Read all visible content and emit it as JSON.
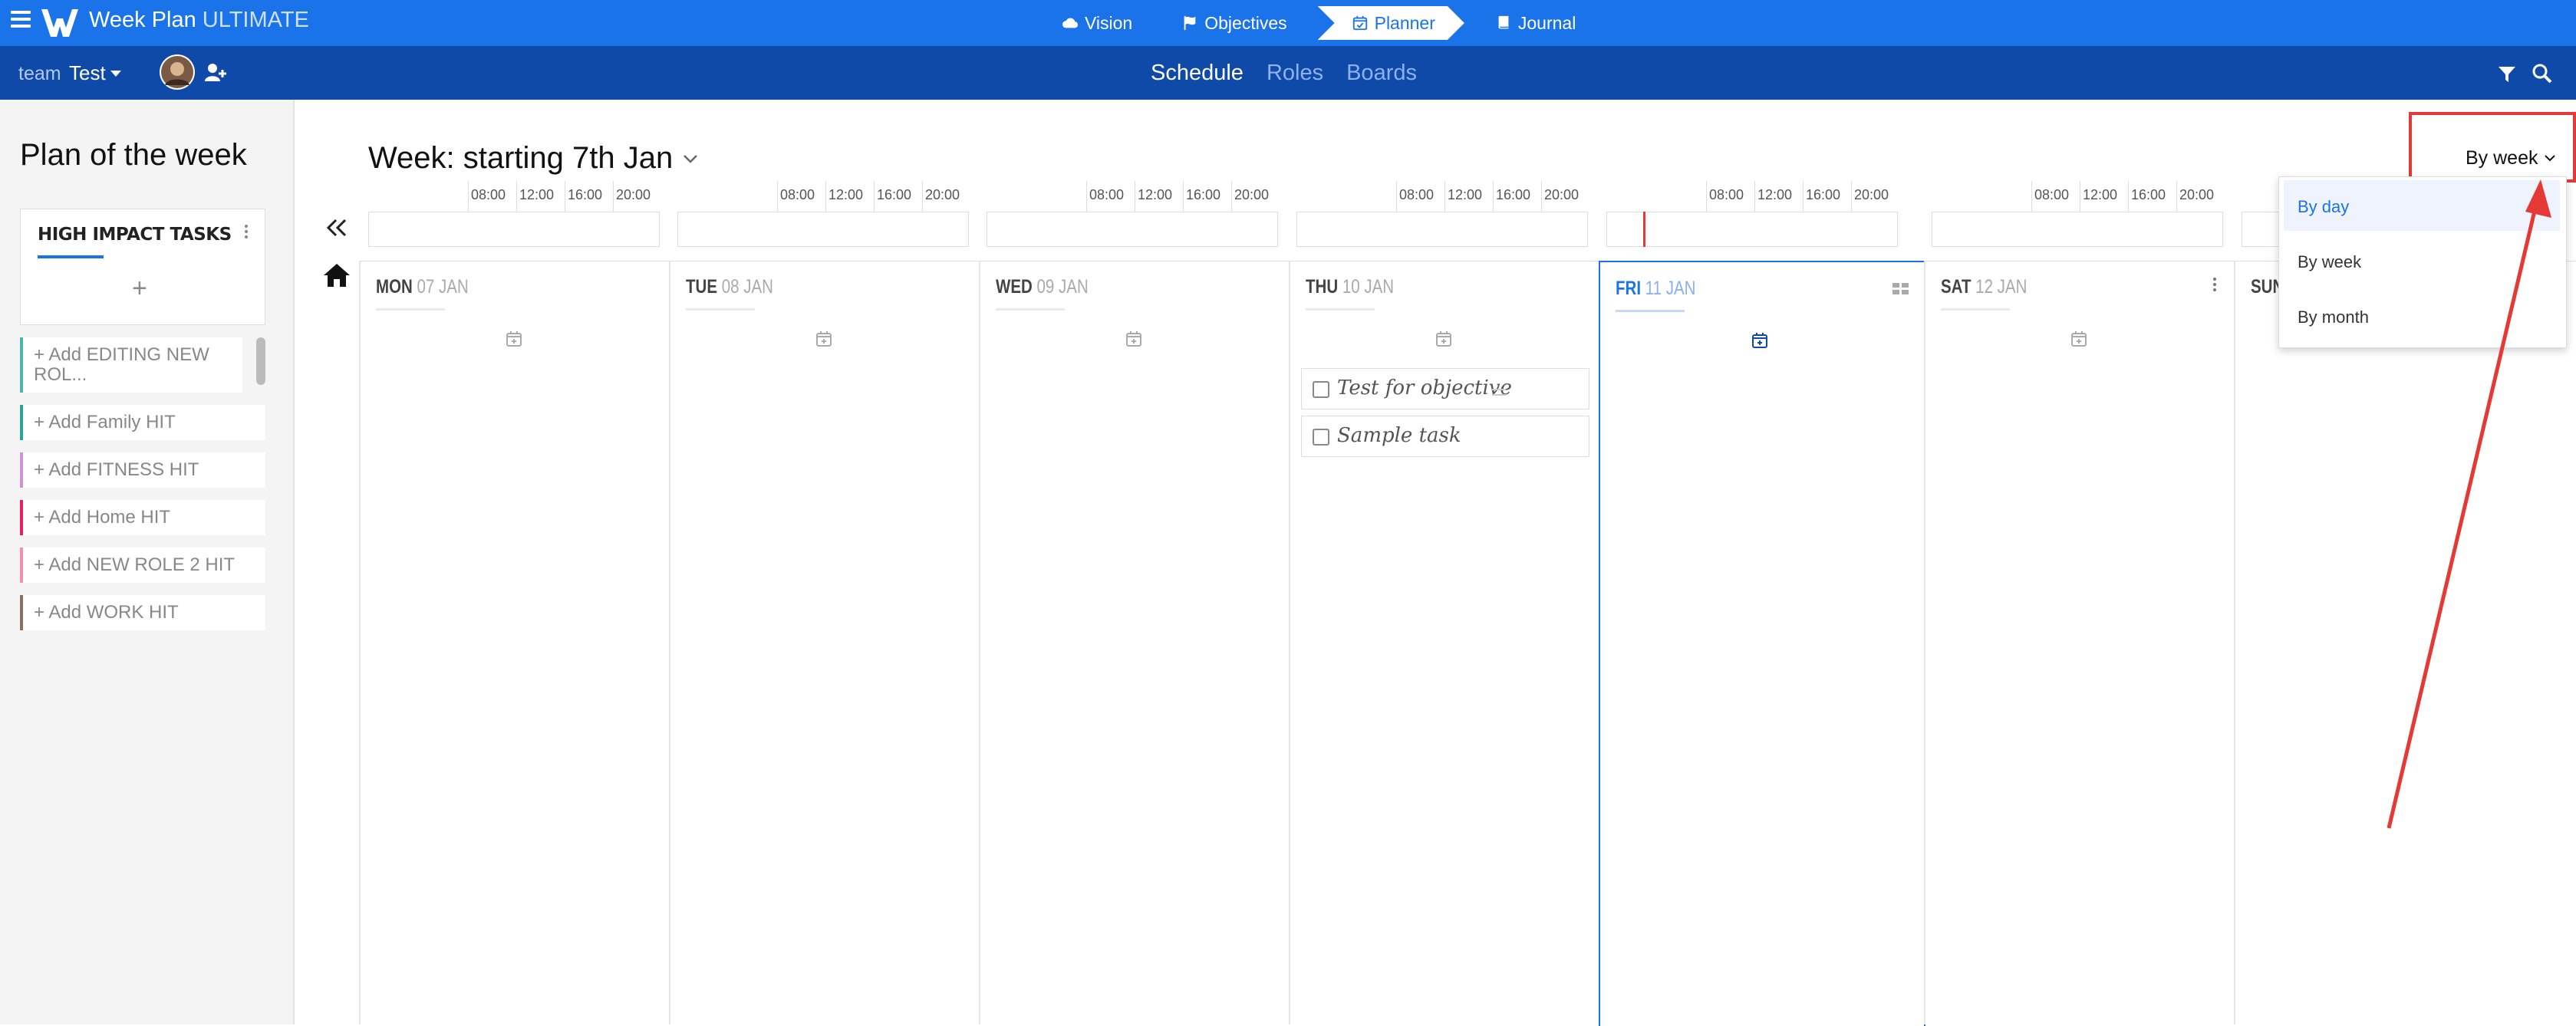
{
  "app": {
    "brand_main": "Week Plan",
    "brand_suffix": "ULTIMATE",
    "accent": "#1a73e8",
    "nav": [
      {
        "label": "Vision",
        "icon": "cloud-icon"
      },
      {
        "label": "Objectives",
        "icon": "flag-icon"
      },
      {
        "label": "Planner",
        "icon": "calendar-check-icon",
        "active": true
      },
      {
        "label": "Journal",
        "icon": "book-icon"
      }
    ]
  },
  "subbar": {
    "team_label": "team",
    "team_name": "Test",
    "tabs": [
      {
        "label": "Schedule",
        "active": true
      },
      {
        "label": "Roles"
      },
      {
        "label": "Boards"
      }
    ]
  },
  "left_panel": {
    "title": "Plan of the week",
    "hit_title": "HIGH IMPACT TASKS",
    "hit_add": "+",
    "roles": [
      {
        "label": "+ Add EDITING NEW ROL...",
        "color": "#4db6ac"
      },
      {
        "label": "+ Add Family HIT",
        "color": "#26a69a"
      },
      {
        "label": "+ Add FITNESS HIT",
        "color": "#ce93d8"
      },
      {
        "label": "+ Add Home HIT",
        "color": "#e91e63"
      },
      {
        "label": "+ Add NEW ROLE 2 HIT",
        "color": "#f48fb1"
      },
      {
        "label": "+ Add WORK HIT",
        "color": "#8d6e63"
      }
    ]
  },
  "planner": {
    "week_title": "Week: starting 7th Jan",
    "time_labels": [
      "08:00",
      "12:00",
      "16:00",
      "20:00"
    ],
    "days": [
      {
        "name": "MON",
        "date": "07 JAN"
      },
      {
        "name": "TUE",
        "date": "08 JAN"
      },
      {
        "name": "WED",
        "date": "09 JAN"
      },
      {
        "name": "THU",
        "date": "10 JAN",
        "tasks": [
          "Test for objective",
          "Sample task"
        ]
      },
      {
        "name": "FRI",
        "date": "11 JAN",
        "today": true
      },
      {
        "name": "SAT",
        "date": "12 JAN"
      },
      {
        "name": "SUN",
        "date": ""
      }
    ],
    "view_button": "By week",
    "view_options": [
      {
        "label": "By day",
        "selected": true
      },
      {
        "label": "By week"
      },
      {
        "label": "By month"
      }
    ]
  }
}
